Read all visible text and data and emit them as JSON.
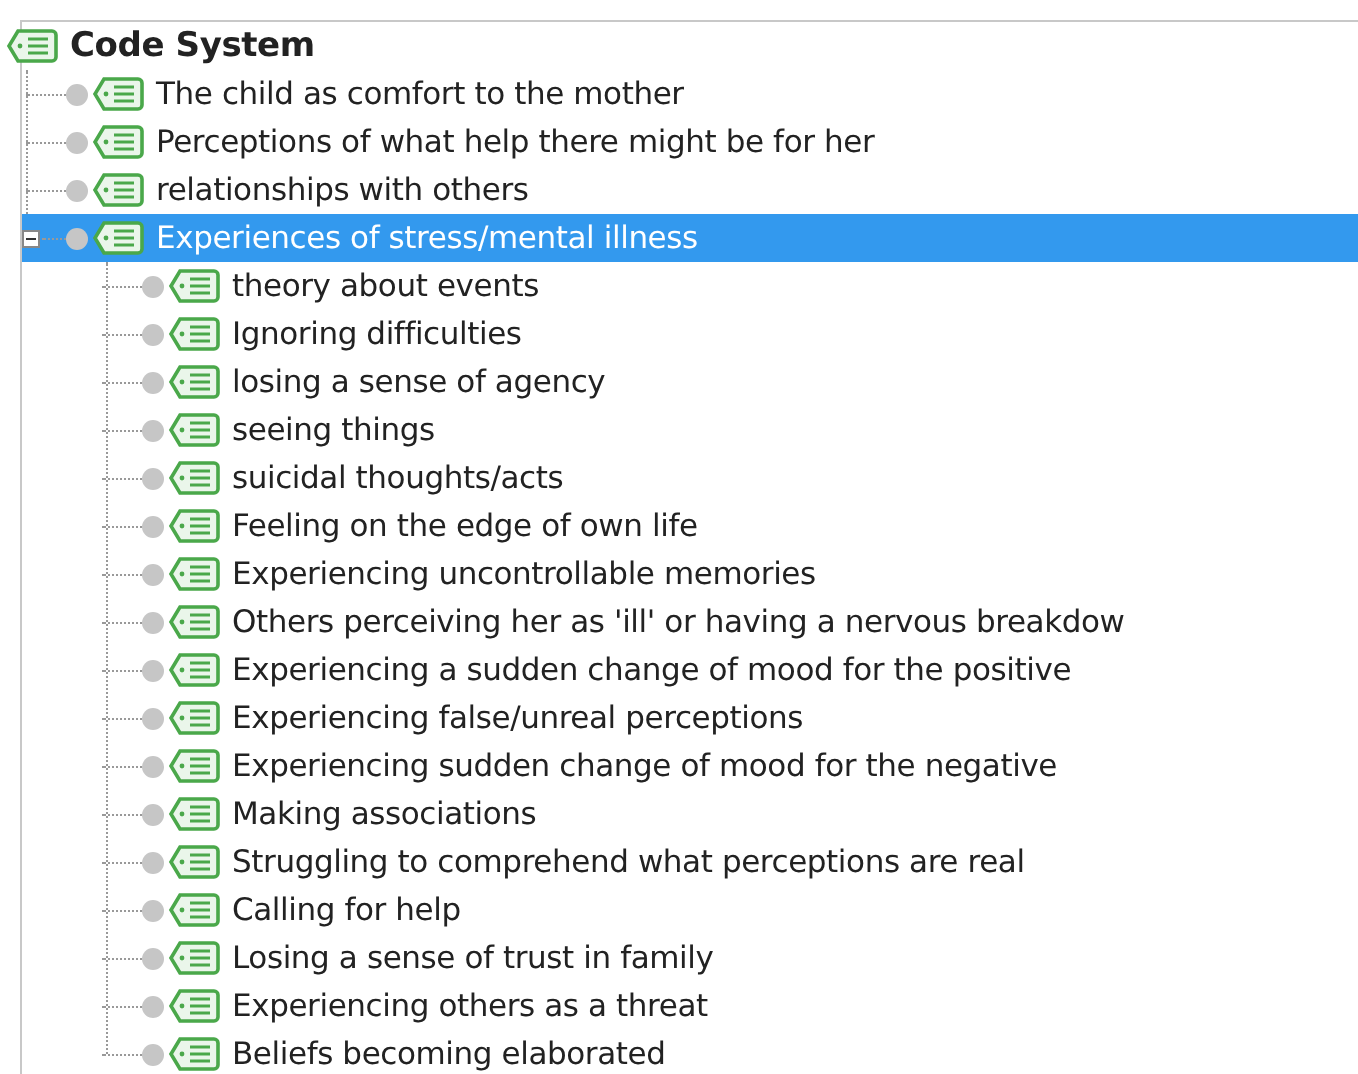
{
  "code_system": {
    "label": "Code System",
    "children": [
      {
        "label": "The child as comfort to the mother",
        "selected": false
      },
      {
        "label": "Perceptions of what help there might be for her",
        "selected": false
      },
      {
        "label": "relationships with others",
        "selected": false
      },
      {
        "label": "Experiences of stress/mental illness",
        "selected": true,
        "expanded": true,
        "children": [
          {
            "label": "theory about events",
            "selected": false
          },
          {
            "label": "Ignoring difficulties",
            "selected": false
          },
          {
            "label": "losing a sense of agency",
            "selected": false
          },
          {
            "label": "seeing things",
            "selected": false
          },
          {
            "label": "suicidal thoughts/acts",
            "selected": false
          },
          {
            "label": "Feeling on the edge of own life",
            "selected": false
          },
          {
            "label": "Experiencing uncontrollable memories",
            "selected": false
          },
          {
            "label": "Others perceiving her as 'ill' or having a nervous breakdow",
            "selected": false
          },
          {
            "label": "Experiencing a sudden change of mood for the positive",
            "selected": false
          },
          {
            "label": "Experiencing false/unreal perceptions",
            "selected": false
          },
          {
            "label": "Experiencing sudden change of mood for the negative",
            "selected": false
          },
          {
            "label": "Making associations",
            "selected": false
          },
          {
            "label": "Struggling to comprehend what perceptions are real",
            "selected": false
          },
          {
            "label": "Calling for help",
            "selected": false
          },
          {
            "label": "Losing a sense of trust in family",
            "selected": false
          },
          {
            "label": "Experiencing others as a threat",
            "selected": false
          },
          {
            "label": "Beliefs becoming elaborated",
            "selected": false
          }
        ]
      }
    ]
  }
}
